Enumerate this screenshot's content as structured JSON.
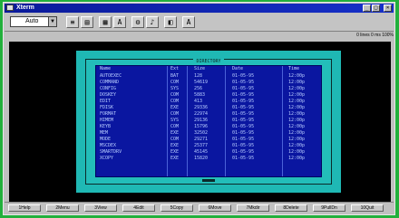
{
  "window": {
    "title": "Xterm"
  },
  "toolbar": {
    "font_select_value": "Auto",
    "tools": [
      {
        "icon": "menu-icon",
        "glyph": "≡"
      },
      {
        "icon": "copy-icon",
        "glyph": "▤"
      },
      {
        "icon": "paste-icon",
        "glyph": "▦"
      },
      {
        "icon": "font-icon",
        "glyph": "A"
      },
      {
        "icon": "settings-icon",
        "glyph": "⚙"
      },
      {
        "icon": "sound-icon",
        "glyph": "♪"
      },
      {
        "icon": "background-icon",
        "glyph": "◧"
      },
      {
        "icon": "font-size-icon",
        "glyph": "A"
      }
    ]
  },
  "status": {
    "text": "0 lines 0 ms 100%"
  },
  "dialog": {
    "title": "DIRECTORY"
  },
  "list": {
    "columns": [
      "Name",
      "Ext",
      "Size",
      "Date",
      "Time"
    ],
    "rows": [
      {
        "name": "AUTOEXEC",
        "ext": "BAT",
        "size": "128",
        "date": "01-05-95",
        "time": "12:00p"
      },
      {
        "name": "COMMAND",
        "ext": "COM",
        "size": "54619",
        "date": "01-05-95",
        "time": "12:00p"
      },
      {
        "name": "CONFIG",
        "ext": "SYS",
        "size": "256",
        "date": "01-05-95",
        "time": "12:00p"
      },
      {
        "name": "DOSKEY",
        "ext": "COM",
        "size": "5883",
        "date": "01-05-95",
        "time": "12:00p"
      },
      {
        "name": "EDIT",
        "ext": "COM",
        "size": "413",
        "date": "01-05-95",
        "time": "12:00p"
      },
      {
        "name": "FDISK",
        "ext": "EXE",
        "size": "29336",
        "date": "01-05-95",
        "time": "12:00p"
      },
      {
        "name": "FORMAT",
        "ext": "COM",
        "size": "22974",
        "date": "01-05-95",
        "time": "12:00p"
      },
      {
        "name": "HIMEM",
        "ext": "SYS",
        "size": "29136",
        "date": "01-05-95",
        "time": "12:00p"
      },
      {
        "name": "KEYB",
        "ext": "COM",
        "size": "15796",
        "date": "01-05-95",
        "time": "12:00p"
      },
      {
        "name": "MEM",
        "ext": "EXE",
        "size": "32502",
        "date": "01-05-95",
        "time": "12:00p"
      },
      {
        "name": "MODE",
        "ext": "COM",
        "size": "29271",
        "date": "01-05-95",
        "time": "12:00p"
      },
      {
        "name": "MSCDEX",
        "ext": "EXE",
        "size": "25377",
        "date": "01-05-95",
        "time": "12:00p"
      },
      {
        "name": "SMARTDRV",
        "ext": "EXE",
        "size": "45145",
        "date": "01-05-95",
        "time": "12:00p"
      },
      {
        "name": "XCOPY",
        "ext": "EXE",
        "size": "15820",
        "date": "01-05-95",
        "time": "12:00p"
      }
    ]
  },
  "fnbar": {
    "keys": [
      "1Help",
      "2Menu",
      "3View",
      "4Edit",
      "5Copy",
      "6Move",
      "7Mkdir",
      "8Delete",
      "9PullDn",
      "10Quit"
    ]
  }
}
